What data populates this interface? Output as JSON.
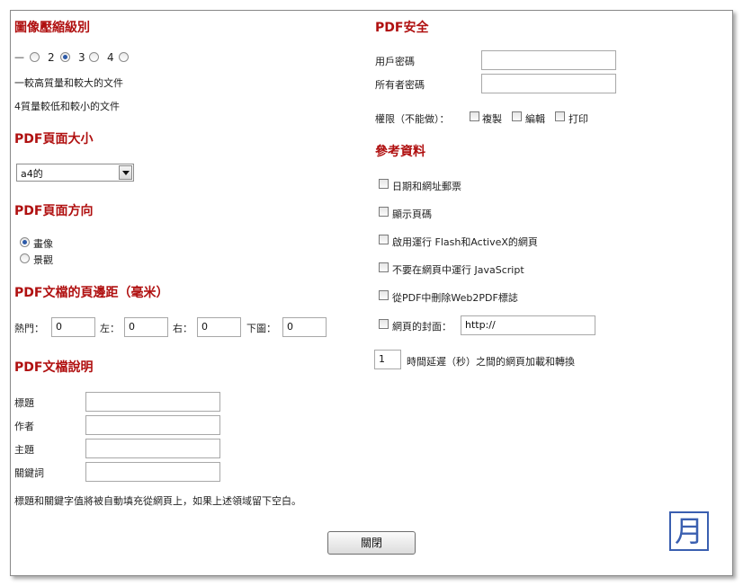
{
  "compression": {
    "title": "圖像壓縮級別",
    "dash": "—",
    "levels": [
      "2",
      "3",
      "4"
    ],
    "selected": "3",
    "note1": "一較高質量和較大的文件",
    "note2": "4質量較低和較小的文件"
  },
  "page_size": {
    "title": "PDF頁面大小",
    "value": "a4的"
  },
  "orientation": {
    "title": "PDF頁面方向",
    "options": [
      "畫像",
      "景觀"
    ],
    "selected": "畫像"
  },
  "margins": {
    "title": "PDF文檔的頁邊距（毫米）",
    "top_label": "熱門：",
    "top_value": "0",
    "left_label": "左：",
    "left_value": "0",
    "right_label": "右：",
    "right_value": "0",
    "bottom_label": "下圖：",
    "bottom_value": "0"
  },
  "description": {
    "title": "PDF文檔說明",
    "fields": [
      "標題",
      "作者",
      "主題",
      "關鍵詞"
    ],
    "note": "標題和關鍵字值將被自動填充從網頁上，如果上述領域留下空白。"
  },
  "security": {
    "title": "PDF安全",
    "user_password_label": "用戶密碼",
    "owner_password_label": "所有者密碼",
    "permissions_label": "權限（不能做）：",
    "permissions": [
      "複製",
      "編輯",
      "打印"
    ]
  },
  "references": {
    "title": "參考資料",
    "options": [
      "日期和網址郵票",
      "顯示頁碼",
      "啟用運行 Flash和ActiveX的網頁",
      "不要在網頁中運行 JavaScript",
      "從PDF中刪除Web2PDF標誌",
      "網頁的封面："
    ],
    "cover_value": "http://",
    "delay_value": "1",
    "delay_label": "時間延遲（秒）之間的網頁加載和轉換"
  },
  "actions": {
    "close_label": "關閉"
  },
  "logo": {
    "glyph": "月",
    "color": "#3a5fb0"
  },
  "colors": {
    "heading": "#b01010",
    "radio_dot": "#2c5aa8"
  }
}
